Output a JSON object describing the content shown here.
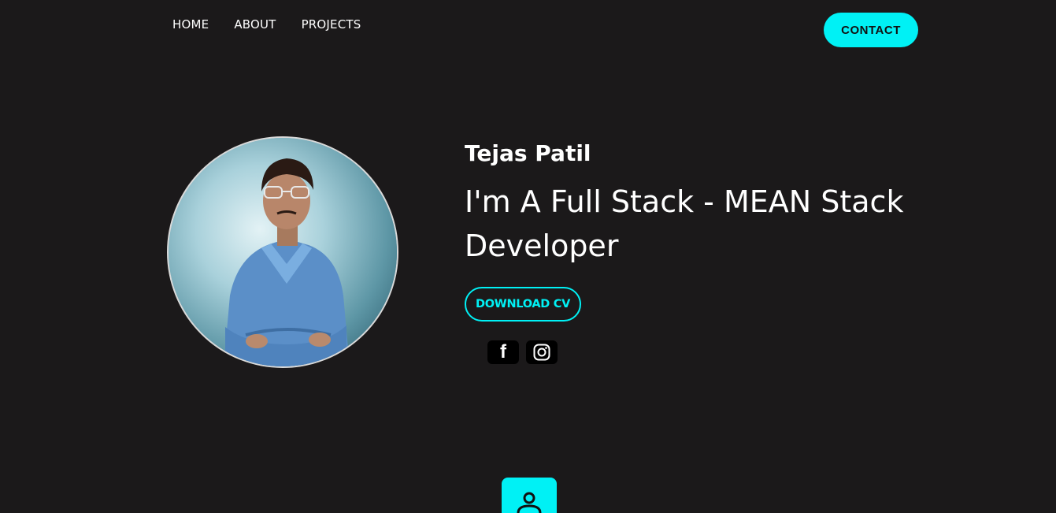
{
  "nav": {
    "items": [
      {
        "label": "HOME"
      },
      {
        "label": "ABOUT"
      },
      {
        "label": "PROJECTS"
      }
    ],
    "contact_label": "CONTACT"
  },
  "hero": {
    "name": "Tejas Patil",
    "headline": "I'm A Full Stack - MEAN Stack Developer",
    "download_label": "DOWNLOAD CV",
    "social": [
      {
        "icon": "facebook-icon",
        "glyph": "f"
      },
      {
        "icon": "instagram-icon"
      }
    ]
  },
  "bottom": {
    "icon": "person-icon"
  },
  "colors": {
    "background": "#1b191a",
    "accent": "#00f1f5",
    "text": "#ffffff"
  }
}
